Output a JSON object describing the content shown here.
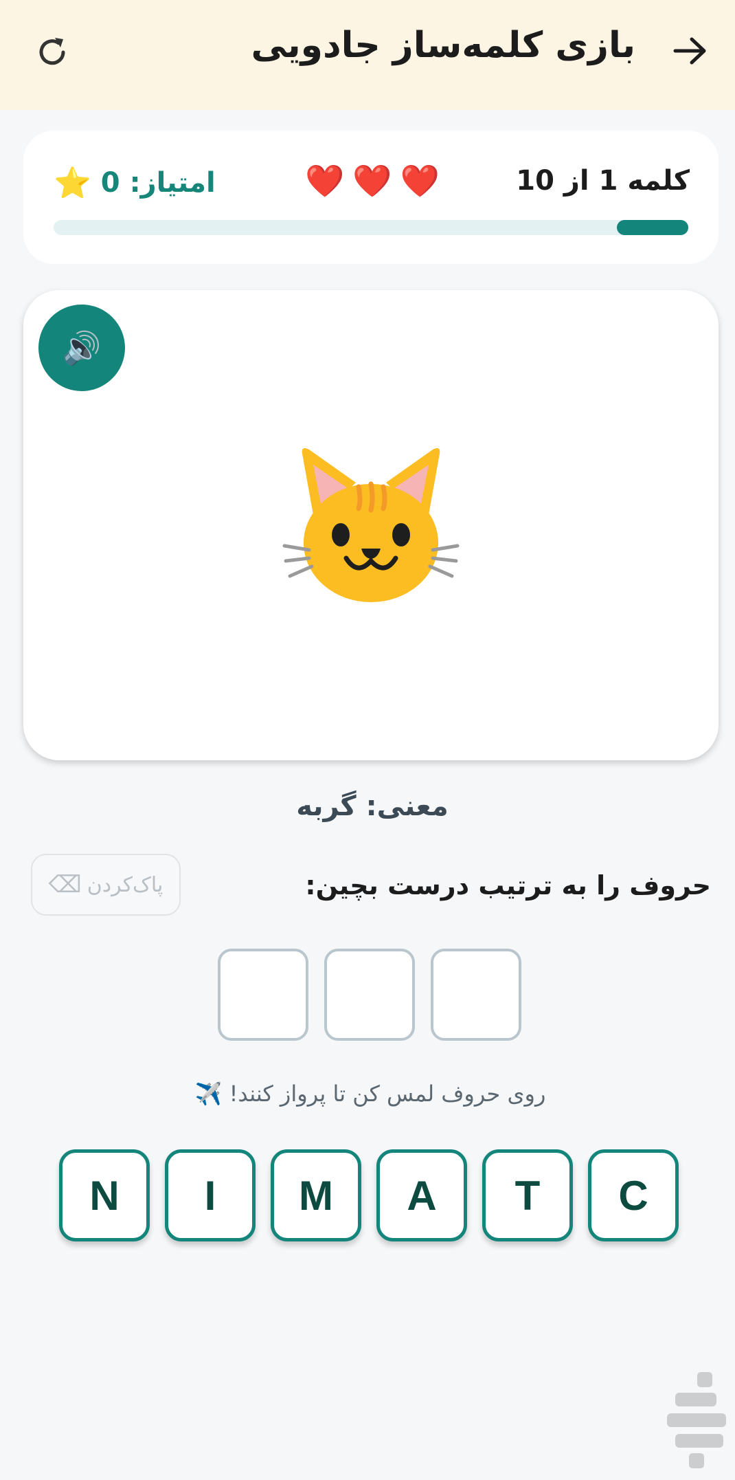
{
  "header": {
    "title": "بازی کلمه‌ساز جادویی",
    "back_icon": "arrow-right-icon",
    "refresh_icon": "refresh-icon"
  },
  "stats": {
    "word_progress": "کلمه 1 از 10",
    "current_word": 1,
    "total_words": 10,
    "hearts": "❤️❤️❤️",
    "lives": 3,
    "score_label": "امتیاز: 0",
    "star": "⭐",
    "progress_fraction": 0.1
  },
  "picture": {
    "speaker_icon": "🔊",
    "image_icon": "cat-face-icon"
  },
  "meaning": "معنی: گربه",
  "instruction": "حروف را به ترتیب درست بچین:",
  "clear_button": {
    "label": "پاک‌کردن",
    "icon": "⌫"
  },
  "answer_slots": [
    "",
    "",
    ""
  ],
  "hint": "روی حروف لمس کن تا پرواز کنند! ✈️",
  "letters": [
    "N",
    "I",
    "M",
    "A",
    "T",
    "C"
  ],
  "colors": {
    "accent": "#14857a",
    "header_bg": "#fdf5e4",
    "page_bg": "#f5f7f9",
    "tile_text": "#0d4a3f"
  }
}
